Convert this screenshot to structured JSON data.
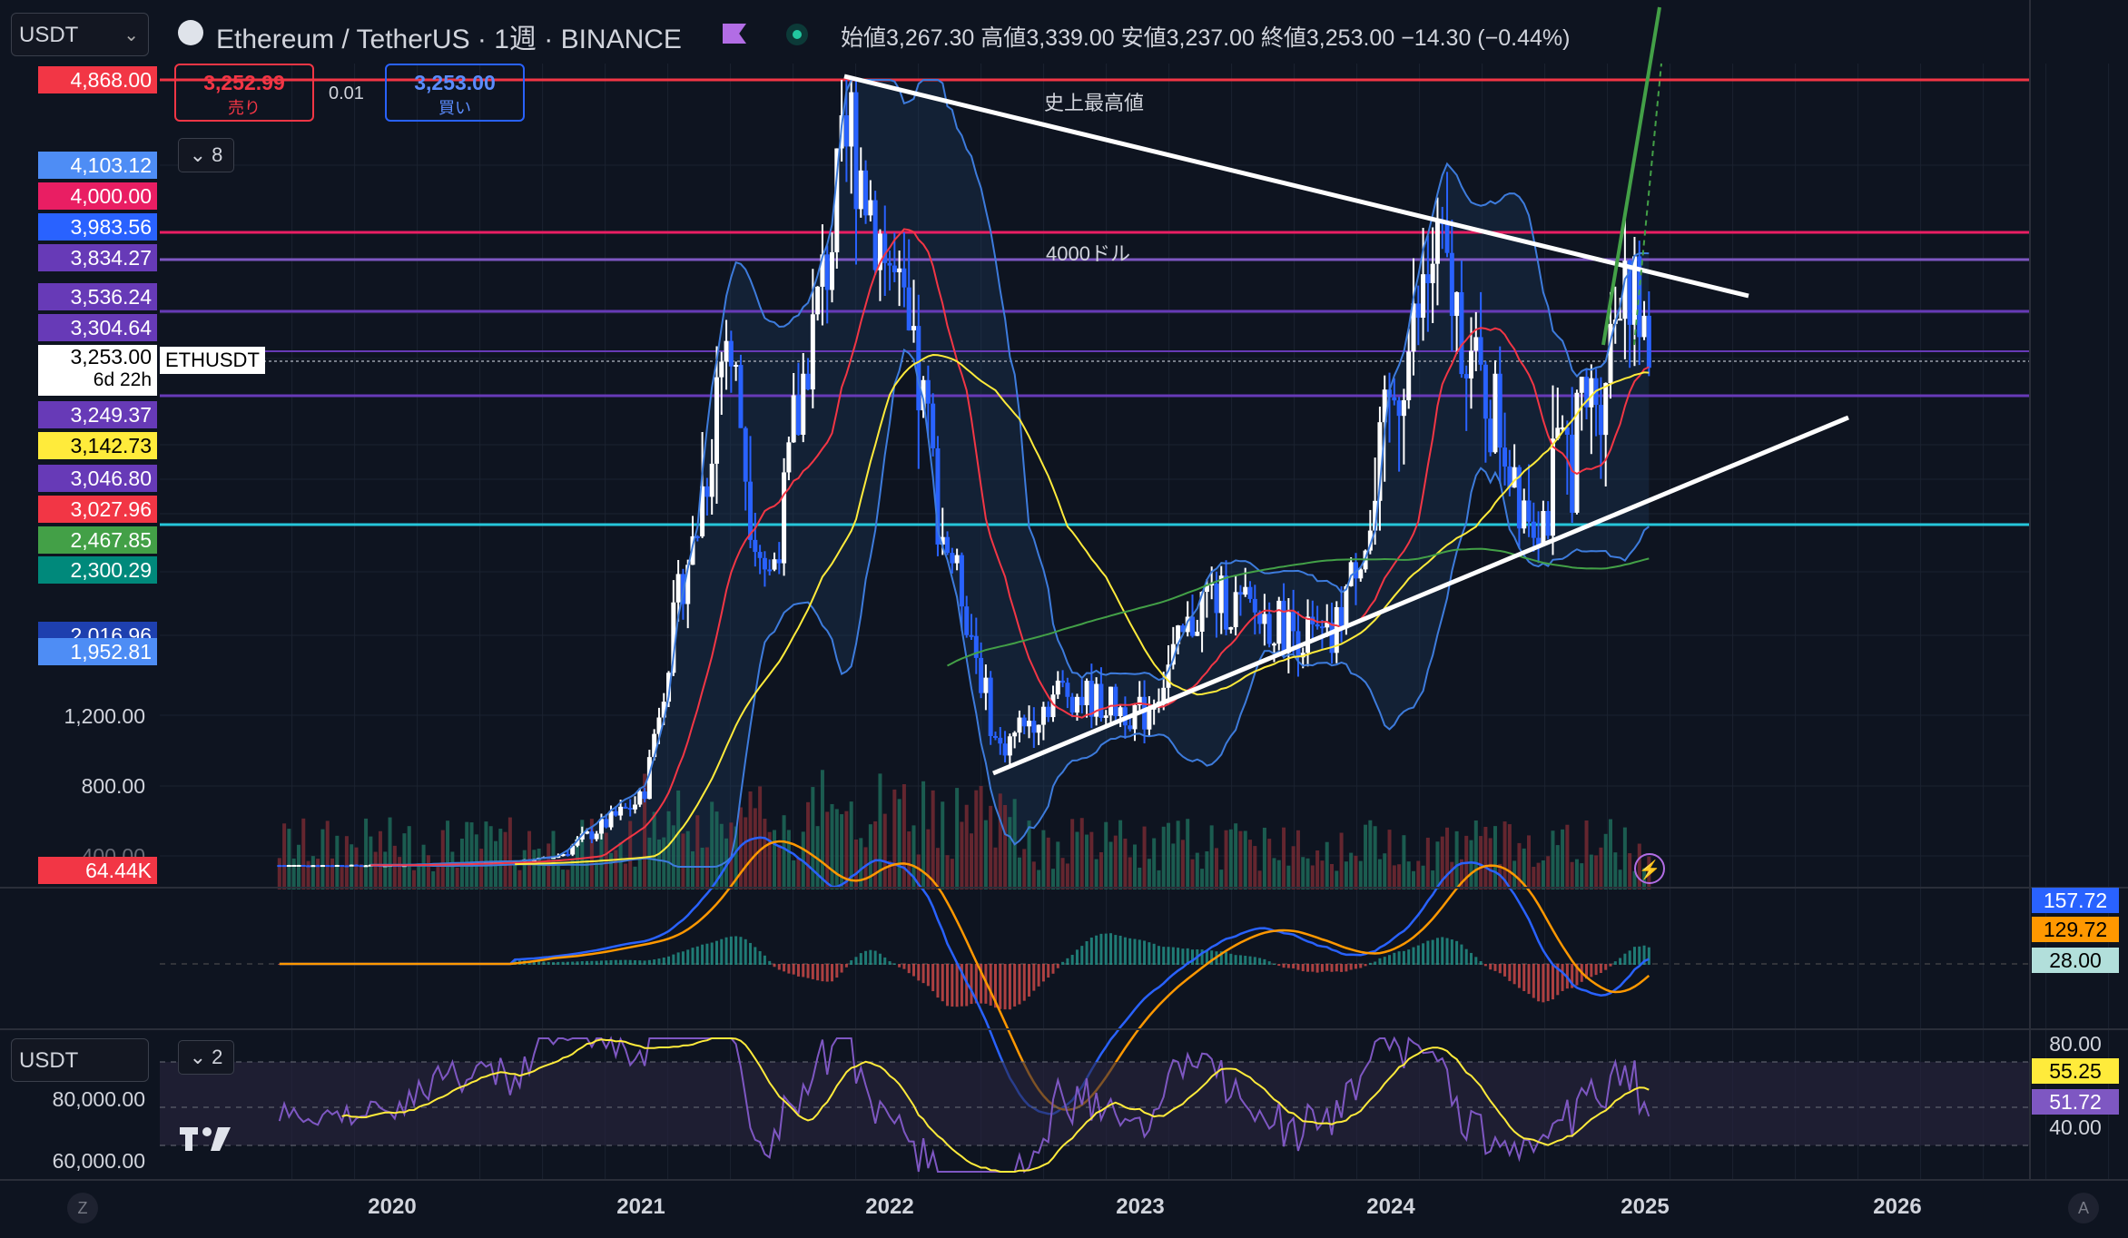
{
  "header": {
    "currency_select": "USDT",
    "symbol_title": "Ethereum / TetherUS · 1週 · BINANCE",
    "ohlc": [
      {
        "label": "始値",
        "value": "3,267.30"
      },
      {
        "label": "高値",
        "value": "3,339.00"
      },
      {
        "label": "安値",
        "value": "3,237.00"
      },
      {
        "label": "終値",
        "value": "3,253.00"
      }
    ],
    "change": "−14.30 (−0.44%)"
  },
  "trade": {
    "sell_price": "3,252.99",
    "sell_label": "売り",
    "spread": "0.01",
    "buy_price": "3,253.00",
    "buy_label": "買い"
  },
  "indicators_collapsed_count": "8",
  "rsi_collapsed_count": "2",
  "lower_pane_select": "USDT",
  "symbol_label": "ETHUSDT",
  "countdown": "6d 22h",
  "annotations": {
    "ath": "史上最高値",
    "level_4000": "4000ドル"
  },
  "price_tags": [
    {
      "text": "4,868.00",
      "color": "#f23645",
      "price": 4868
    },
    {
      "text": "4,103.12",
      "color": "#4e8df5",
      "price": 4103.12
    },
    {
      "text": "4,000.00",
      "color": "#e91e63",
      "price": 4000
    },
    {
      "text": "3,983.56",
      "color": "#2962ff",
      "price": 3983.56
    },
    {
      "text": "3,834.27",
      "color": "#673ab7",
      "price": 3834.27
    },
    {
      "text": "3,536.24",
      "color": "#673ab7",
      "price": 3536.24
    },
    {
      "text": "3,304.64",
      "color": "#673ab7",
      "price": 3304.64
    },
    {
      "text": "3,249.37",
      "color": "#673ab7",
      "price": 3249.37
    },
    {
      "text": "3,142.73",
      "color": "#ffeb3b",
      "price": 3142.73
    },
    {
      "text": "3,046.80",
      "color": "#673ab7",
      "price": 3046.8
    },
    {
      "text": "3,027.96",
      "color": "#f23645",
      "price": 3027.96
    },
    {
      "text": "2,467.85",
      "color": "#43a047",
      "price": 2467.85
    },
    {
      "text": "2,300.29",
      "color": "#00897b",
      "price": 2300.29
    },
    {
      "text": "2,016.96",
      "color": "#1e40af",
      "price": 2016.96
    },
    {
      "text": "1,952.81",
      "color": "#4e8df5",
      "price": 1952.81
    }
  ],
  "current_price_tag": "3,253.00",
  "volume_tag": "64.44K",
  "macd_tags": [
    {
      "text": "157.72",
      "color": "#2962ff"
    },
    {
      "text": "129.72",
      "color": "#ff9800"
    },
    {
      "text": "28.00",
      "color": "#b2dfdb"
    }
  ],
  "rsi_tags": [
    {
      "text": "80.00",
      "color": "none"
    },
    {
      "text": "55.25",
      "color": "#ffeb3b"
    },
    {
      "text": "51.72",
      "color": "#7e57c2"
    },
    {
      "text": "40.00",
      "color": "none"
    }
  ],
  "rsi_left_ticks": [
    "80,000.00",
    "60,000.00"
  ],
  "corner_left": "Z",
  "corner_right": "A",
  "chart_data": {
    "type": "candlestick",
    "timeframe": "1週",
    "exchange": "BINANCE",
    "x_ticks": [
      "2020",
      "2021",
      "2022",
      "2023",
      "2024",
      "2025",
      "2026"
    ],
    "y_ticks": [
      "1,200.00",
      "800.00",
      "400.00"
    ],
    "horizontal_levels": [
      4868,
      4000,
      3834.27,
      3536.24,
      3304.64,
      3253,
      3046.8,
      2300.29
    ],
    "series_approx_close": {
      "x": [
        "2020-01",
        "2020-07",
        "2021-01",
        "2021-05",
        "2021-07",
        "2021-11",
        "2022-01",
        "2022-06",
        "2022-09",
        "2023-01",
        "2023-04",
        "2023-10",
        "2024-03",
        "2024-05",
        "2024-08",
        "2024-11",
        "2024-12",
        "2025-01"
      ],
      "close": [
        130,
        240,
        730,
        3400,
        2000,
        4600,
        3700,
        1000,
        1350,
        1200,
        1900,
        1600,
        3900,
        3100,
        2500,
        3100,
        3900,
        3253
      ]
    }
  }
}
